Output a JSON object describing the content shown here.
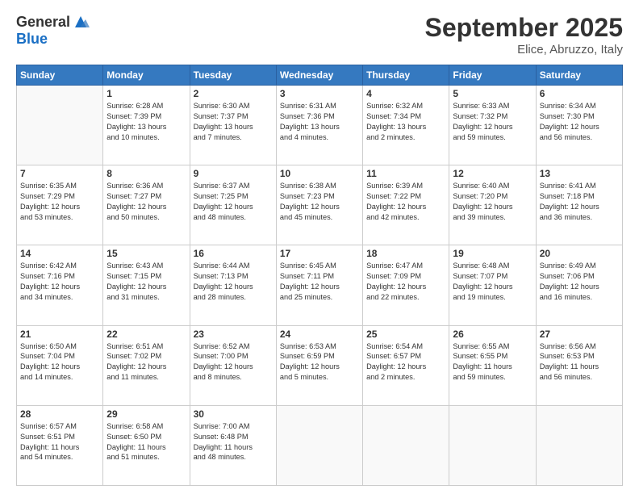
{
  "header": {
    "logo_general": "General",
    "logo_blue": "Blue",
    "month": "September 2025",
    "location": "Elice, Abruzzo, Italy"
  },
  "days_of_week": [
    "Sunday",
    "Monday",
    "Tuesday",
    "Wednesday",
    "Thursday",
    "Friday",
    "Saturday"
  ],
  "weeks": [
    [
      {
        "day": "",
        "lines": []
      },
      {
        "day": "1",
        "lines": [
          "Sunrise: 6:28 AM",
          "Sunset: 7:39 PM",
          "Daylight: 13 hours",
          "and 10 minutes."
        ]
      },
      {
        "day": "2",
        "lines": [
          "Sunrise: 6:30 AM",
          "Sunset: 7:37 PM",
          "Daylight: 13 hours",
          "and 7 minutes."
        ]
      },
      {
        "day": "3",
        "lines": [
          "Sunrise: 6:31 AM",
          "Sunset: 7:36 PM",
          "Daylight: 13 hours",
          "and 4 minutes."
        ]
      },
      {
        "day": "4",
        "lines": [
          "Sunrise: 6:32 AM",
          "Sunset: 7:34 PM",
          "Daylight: 13 hours",
          "and 2 minutes."
        ]
      },
      {
        "day": "5",
        "lines": [
          "Sunrise: 6:33 AM",
          "Sunset: 7:32 PM",
          "Daylight: 12 hours",
          "and 59 minutes."
        ]
      },
      {
        "day": "6",
        "lines": [
          "Sunrise: 6:34 AM",
          "Sunset: 7:30 PM",
          "Daylight: 12 hours",
          "and 56 minutes."
        ]
      }
    ],
    [
      {
        "day": "7",
        "lines": [
          "Sunrise: 6:35 AM",
          "Sunset: 7:29 PM",
          "Daylight: 12 hours",
          "and 53 minutes."
        ]
      },
      {
        "day": "8",
        "lines": [
          "Sunrise: 6:36 AM",
          "Sunset: 7:27 PM",
          "Daylight: 12 hours",
          "and 50 minutes."
        ]
      },
      {
        "day": "9",
        "lines": [
          "Sunrise: 6:37 AM",
          "Sunset: 7:25 PM",
          "Daylight: 12 hours",
          "and 48 minutes."
        ]
      },
      {
        "day": "10",
        "lines": [
          "Sunrise: 6:38 AM",
          "Sunset: 7:23 PM",
          "Daylight: 12 hours",
          "and 45 minutes."
        ]
      },
      {
        "day": "11",
        "lines": [
          "Sunrise: 6:39 AM",
          "Sunset: 7:22 PM",
          "Daylight: 12 hours",
          "and 42 minutes."
        ]
      },
      {
        "day": "12",
        "lines": [
          "Sunrise: 6:40 AM",
          "Sunset: 7:20 PM",
          "Daylight: 12 hours",
          "and 39 minutes."
        ]
      },
      {
        "day": "13",
        "lines": [
          "Sunrise: 6:41 AM",
          "Sunset: 7:18 PM",
          "Daylight: 12 hours",
          "and 36 minutes."
        ]
      }
    ],
    [
      {
        "day": "14",
        "lines": [
          "Sunrise: 6:42 AM",
          "Sunset: 7:16 PM",
          "Daylight: 12 hours",
          "and 34 minutes."
        ]
      },
      {
        "day": "15",
        "lines": [
          "Sunrise: 6:43 AM",
          "Sunset: 7:15 PM",
          "Daylight: 12 hours",
          "and 31 minutes."
        ]
      },
      {
        "day": "16",
        "lines": [
          "Sunrise: 6:44 AM",
          "Sunset: 7:13 PM",
          "Daylight: 12 hours",
          "and 28 minutes."
        ]
      },
      {
        "day": "17",
        "lines": [
          "Sunrise: 6:45 AM",
          "Sunset: 7:11 PM",
          "Daylight: 12 hours",
          "and 25 minutes."
        ]
      },
      {
        "day": "18",
        "lines": [
          "Sunrise: 6:47 AM",
          "Sunset: 7:09 PM",
          "Daylight: 12 hours",
          "and 22 minutes."
        ]
      },
      {
        "day": "19",
        "lines": [
          "Sunrise: 6:48 AM",
          "Sunset: 7:07 PM",
          "Daylight: 12 hours",
          "and 19 minutes."
        ]
      },
      {
        "day": "20",
        "lines": [
          "Sunrise: 6:49 AM",
          "Sunset: 7:06 PM",
          "Daylight: 12 hours",
          "and 16 minutes."
        ]
      }
    ],
    [
      {
        "day": "21",
        "lines": [
          "Sunrise: 6:50 AM",
          "Sunset: 7:04 PM",
          "Daylight: 12 hours",
          "and 14 minutes."
        ]
      },
      {
        "day": "22",
        "lines": [
          "Sunrise: 6:51 AM",
          "Sunset: 7:02 PM",
          "Daylight: 12 hours",
          "and 11 minutes."
        ]
      },
      {
        "day": "23",
        "lines": [
          "Sunrise: 6:52 AM",
          "Sunset: 7:00 PM",
          "Daylight: 12 hours",
          "and 8 minutes."
        ]
      },
      {
        "day": "24",
        "lines": [
          "Sunrise: 6:53 AM",
          "Sunset: 6:59 PM",
          "Daylight: 12 hours",
          "and 5 minutes."
        ]
      },
      {
        "day": "25",
        "lines": [
          "Sunrise: 6:54 AM",
          "Sunset: 6:57 PM",
          "Daylight: 12 hours",
          "and 2 minutes."
        ]
      },
      {
        "day": "26",
        "lines": [
          "Sunrise: 6:55 AM",
          "Sunset: 6:55 PM",
          "Daylight: 11 hours",
          "and 59 minutes."
        ]
      },
      {
        "day": "27",
        "lines": [
          "Sunrise: 6:56 AM",
          "Sunset: 6:53 PM",
          "Daylight: 11 hours",
          "and 56 minutes."
        ]
      }
    ],
    [
      {
        "day": "28",
        "lines": [
          "Sunrise: 6:57 AM",
          "Sunset: 6:51 PM",
          "Daylight: 11 hours",
          "and 54 minutes."
        ]
      },
      {
        "day": "29",
        "lines": [
          "Sunrise: 6:58 AM",
          "Sunset: 6:50 PM",
          "Daylight: 11 hours",
          "and 51 minutes."
        ]
      },
      {
        "day": "30",
        "lines": [
          "Sunrise: 7:00 AM",
          "Sunset: 6:48 PM",
          "Daylight: 11 hours",
          "and 48 minutes."
        ]
      },
      {
        "day": "",
        "lines": []
      },
      {
        "day": "",
        "lines": []
      },
      {
        "day": "",
        "lines": []
      },
      {
        "day": "",
        "lines": []
      }
    ]
  ]
}
